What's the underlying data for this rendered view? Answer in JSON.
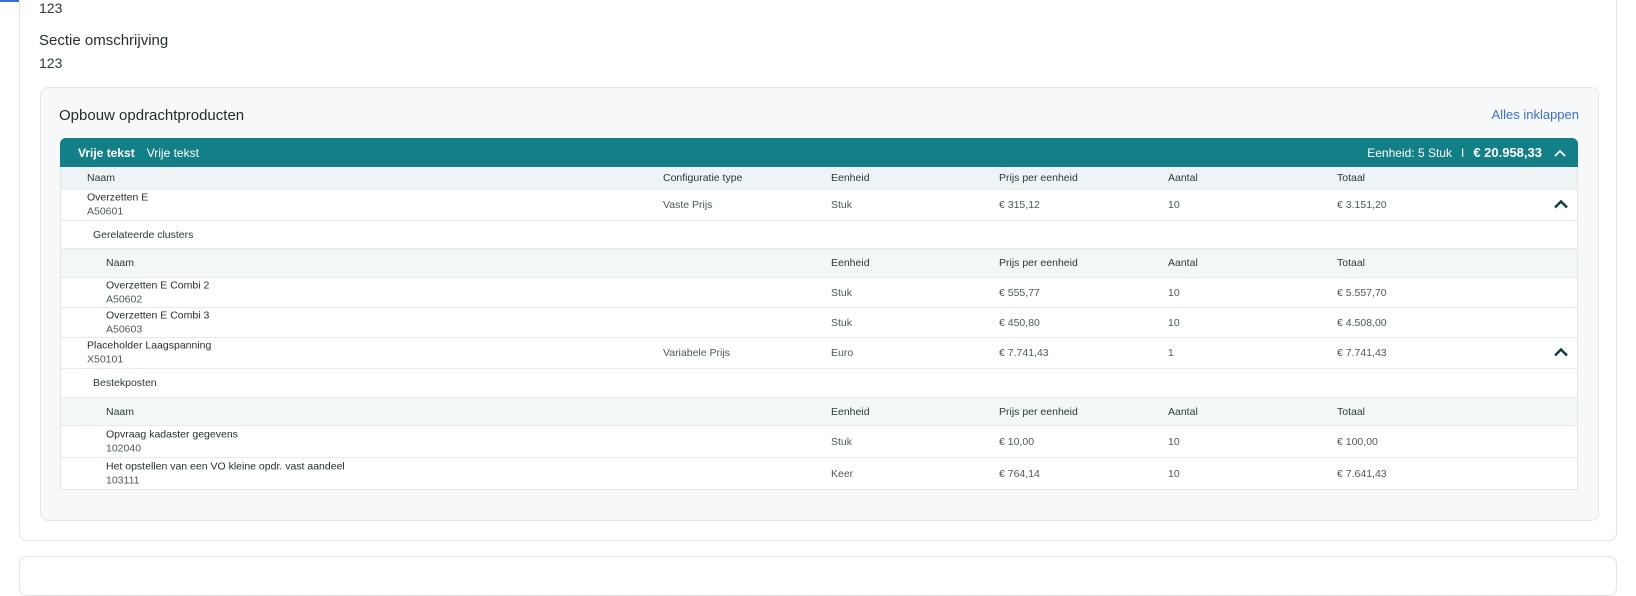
{
  "top_value": "123",
  "section": {
    "label": "Sectie omschrijving",
    "value": "123"
  },
  "panel": {
    "title": "Opbouw opdrachtproducten",
    "collapse_all": "Alles inklappen"
  },
  "group": {
    "type": "Vrije tekst",
    "name": "Vrije tekst",
    "unit_summary": "Eenheid: 5 Stuk",
    "separator": "I",
    "total": "€ 20.958,33",
    "chevron_icon": "chevron-up-icon"
  },
  "columns": {
    "name": "Naam",
    "config": "Configuratie type",
    "unit": "Eenheid",
    "price": "Prijs per eenheid",
    "qty": "Aantal",
    "total": "Totaal"
  },
  "products": [
    {
      "name": "Overzetten E",
      "code": "A50601",
      "config": "Vaste Prijs",
      "unit": "Stuk",
      "price": "€ 315,12",
      "qty": "10",
      "total": "€ 3.151,20",
      "sub_title": "Gerelateerde clusters",
      "items": [
        {
          "name": "Overzetten E Combi 2",
          "code": "A50602",
          "unit": "Stuk",
          "price": "€ 555,77",
          "qty": "10",
          "total": "€ 5.557,70"
        },
        {
          "name": "Overzetten E Combi 3",
          "code": "A50603",
          "unit": "Stuk",
          "price": "€ 450,80",
          "qty": "10",
          "total": "€ 4.508,00"
        }
      ]
    },
    {
      "name": "Placeholder Laagspanning",
      "code": "X50101",
      "config": "Variabele Prijs",
      "unit": "Euro",
      "price": "€ 7.741,43",
      "qty": "1",
      "total": "€ 7.741,43",
      "sub_title": "Bestekposten",
      "items": [
        {
          "name": "Opvraag kadaster gegevens",
          "code": "102040",
          "unit": "Stuk",
          "price": "€ 10,00",
          "qty": "10",
          "total": "€ 100,00"
        },
        {
          "name": "Het opstellen van een VO kleine opdr. vast aandeel",
          "code": "103111",
          "unit": "Keer",
          "price": "€ 764,14",
          "qty": "10",
          "total": "€ 7.641,43"
        }
      ]
    }
  ]
}
